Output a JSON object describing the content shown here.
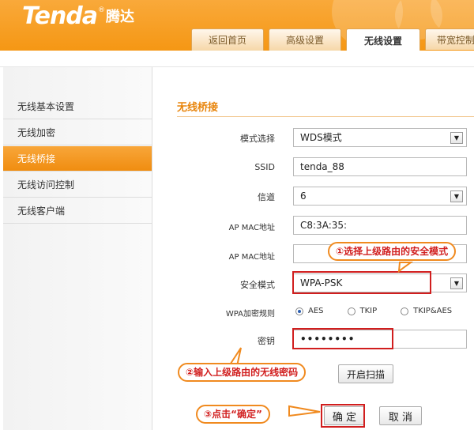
{
  "header": {
    "brand": "Tenda",
    "brand_mark": "®",
    "brand_cn": "腾达",
    "tabs": [
      {
        "label": "返回首页",
        "active": false
      },
      {
        "label": "高级设置",
        "active": false
      },
      {
        "label": "无线设置",
        "active": true
      },
      {
        "label": "带宽控制",
        "active": false
      }
    ]
  },
  "sidebar": {
    "items": [
      {
        "label": "无线基本设置",
        "active": false
      },
      {
        "label": "无线加密",
        "active": false
      },
      {
        "label": "无线桥接",
        "active": true
      },
      {
        "label": "无线访问控制",
        "active": false
      },
      {
        "label": "无线客户端",
        "active": false
      }
    ]
  },
  "main": {
    "section_title": "无线桥接",
    "fields": {
      "mode": {
        "label": "模式选择",
        "value": "WDS模式"
      },
      "ssid": {
        "label": "SSID",
        "value": "tenda_88"
      },
      "channel": {
        "label": "信道",
        "value": "6"
      },
      "ap_mac_1": {
        "label": "AP MAC地址",
        "value": "C8:3A:35:"
      },
      "ap_mac_2": {
        "label": "AP MAC地址",
        "value": ""
      },
      "security": {
        "label": "安全模式",
        "value": "WPA-PSK"
      },
      "wpa_rule": {
        "label": "WPA加密规则",
        "options": [
          "AES",
          "TKIP",
          "TKIP&AES"
        ],
        "selected": "AES"
      },
      "password": {
        "label": "密钥",
        "value": "••••••••"
      }
    },
    "scan_button": "开启扫描",
    "ok_button": "确 定",
    "cancel_button": "取 消"
  },
  "annotations": {
    "step1": "①选择上级路由的安全模式",
    "step2": "②输入上级路由的无线密码",
    "step3": "③点击“确定”"
  },
  "colors": {
    "header_orange": "#f59714",
    "accent_text": "#e8850c",
    "highlight_red": "#d11e1e"
  },
  "icons": {
    "select_arrow": "chevron-down-icon"
  }
}
